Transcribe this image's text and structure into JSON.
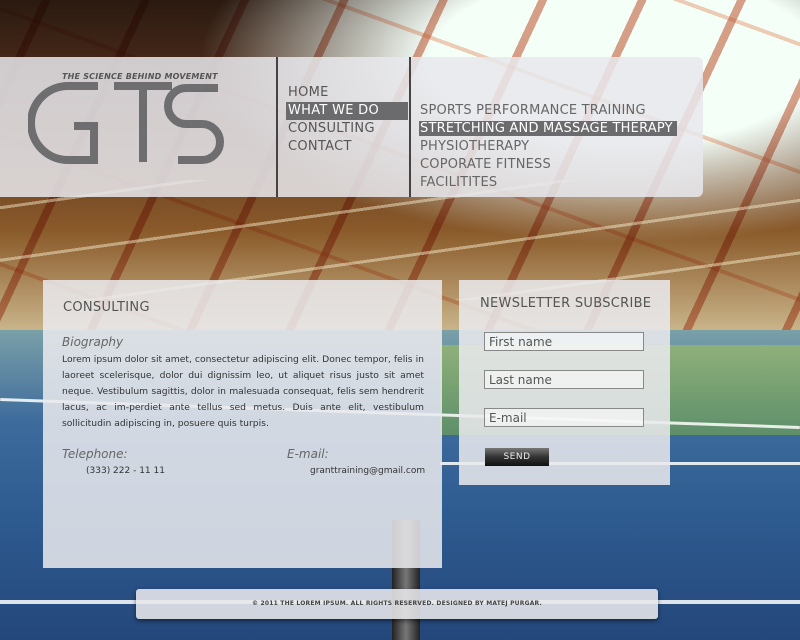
{
  "logo": {
    "tagline": "THE SCIENCE BEHIND MOVEMENT",
    "wordmark": "GTS"
  },
  "nav": {
    "items": [
      {
        "label": "HOME"
      },
      {
        "label": "WHAT WE DO"
      },
      {
        "label": "CONSULTING"
      },
      {
        "label": "CONTACT"
      }
    ],
    "active": "WHAT WE DO"
  },
  "subnav": {
    "items": [
      {
        "label": "SPORTS PERFORMANCE TRAINING"
      },
      {
        "label": "STRETCHING AND MASSAGE THERAPY"
      },
      {
        "label": "PHYSIOTHERAPY"
      },
      {
        "label": "COPORATE FITNESS"
      },
      {
        "label": "FACILITITES"
      }
    ],
    "active": "STRETCHING AND MASSAGE THERAPY"
  },
  "content": {
    "title": "CONSULTING",
    "bio_heading": "Biography",
    "bio_text": "Lorem ipsum dolor sit amet, consectetur adipiscing elit. Donec tempor, felis in laoreet scelerisque, dolor dui dignissim leo, ut aliquet risus justo sit amet neque. Vestibulum sagittis, dolor in malesuada consequat, felis sem hendrerit lacus, ac im-perdiet ante tellus sed metus. Duis ante elit, vestibulum sollicitudin adipiscing in, posuere quis turpis.",
    "telephone_label": "Telephone:",
    "telephone_value": "(333) 222 - 11 11",
    "email_label": "E-mail:",
    "email_value": "granttraining@gmail.com"
  },
  "newsletter": {
    "title": "NEWSLETTER SUBSCRIBE",
    "first_name_placeholder": "First name",
    "last_name_placeholder": "Last name",
    "email_placeholder": "E-mail",
    "send_label": "SEND"
  },
  "footer": {
    "text": "© 2011 THE LOREM IPSUM. ALL RIGHTS RESERVED. DESIGNED BY MATEJ PURGAR."
  },
  "colors": {
    "panel_bg": "#e8e8ec",
    "active_bg": "#6b6b6d",
    "text": "#555555"
  }
}
